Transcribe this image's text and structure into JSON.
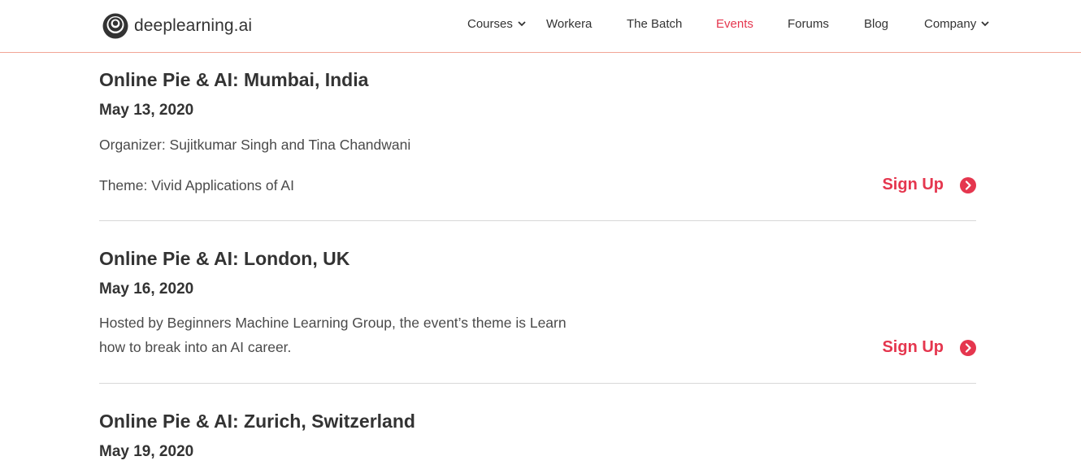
{
  "header": {
    "logo_text": "deeplearning.ai",
    "logo_icon": "deeplearning-logo-mark",
    "nav": [
      {
        "label": "Courses",
        "dropdown": true
      },
      {
        "label": "Workera",
        "dropdown": false
      },
      {
        "label": "The Batch",
        "dropdown": false
      },
      {
        "label": "Events",
        "dropdown": false,
        "active": true
      },
      {
        "label": "Forums",
        "dropdown": false
      },
      {
        "label": "Blog",
        "dropdown": false
      },
      {
        "label": "Company",
        "dropdown": true
      }
    ]
  },
  "events": [
    {
      "title": "Online Pie & AI: Mumbai, India",
      "date": "May 13, 2020",
      "lines": [
        "Organizer: Sujitkumar Singh and Tina Chandwani",
        "Theme: Vivid Applications of AI"
      ],
      "signup_label": "Sign Up"
    },
    {
      "title": "Online Pie & AI: London, UK",
      "date": "May 16, 2020",
      "lines": [
        "Hosted by Beginners Machine Learning Group, the event’s theme is Learn",
        "how to break into an AI career."
      ],
      "signup_label": "Sign Up"
    },
    {
      "title": "Online Pie & AI: Zurich, Switzerland",
      "date": "May 19, 2020"
    }
  ],
  "colors": {
    "accent": "#e5364e",
    "text": "#333333",
    "header_border": "#f1a596",
    "divider": "#d8d8d8"
  }
}
